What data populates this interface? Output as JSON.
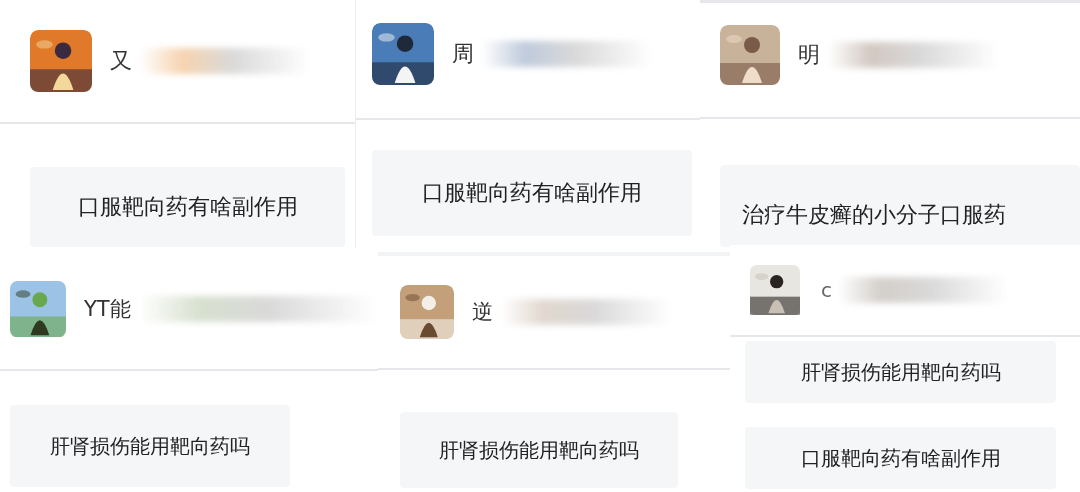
{
  "panels": [
    {
      "user": {
        "name": "又"
      },
      "questions": [
        "口服靶向药有啥副作用"
      ]
    },
    {
      "user": {
        "name": "周"
      },
      "questions": [
        "口服靶向药有啥副作用"
      ]
    },
    {
      "user": {
        "name": "明"
      },
      "questions": [
        "治疗牛皮癣的小分子口服药"
      ]
    },
    {
      "user": {
        "name": "YT能"
      },
      "questions": [
        "肝肾损伤能用靶向药吗"
      ]
    },
    {
      "user": {
        "name": "逆"
      },
      "questions": [
        "肝肾损伤能用靶向药吗"
      ]
    },
    {
      "user": {
        "name": "c"
      },
      "questions": [
        "肝肾损伤能用靶向药吗",
        "口服靶向药有啥副作用"
      ]
    }
  ]
}
